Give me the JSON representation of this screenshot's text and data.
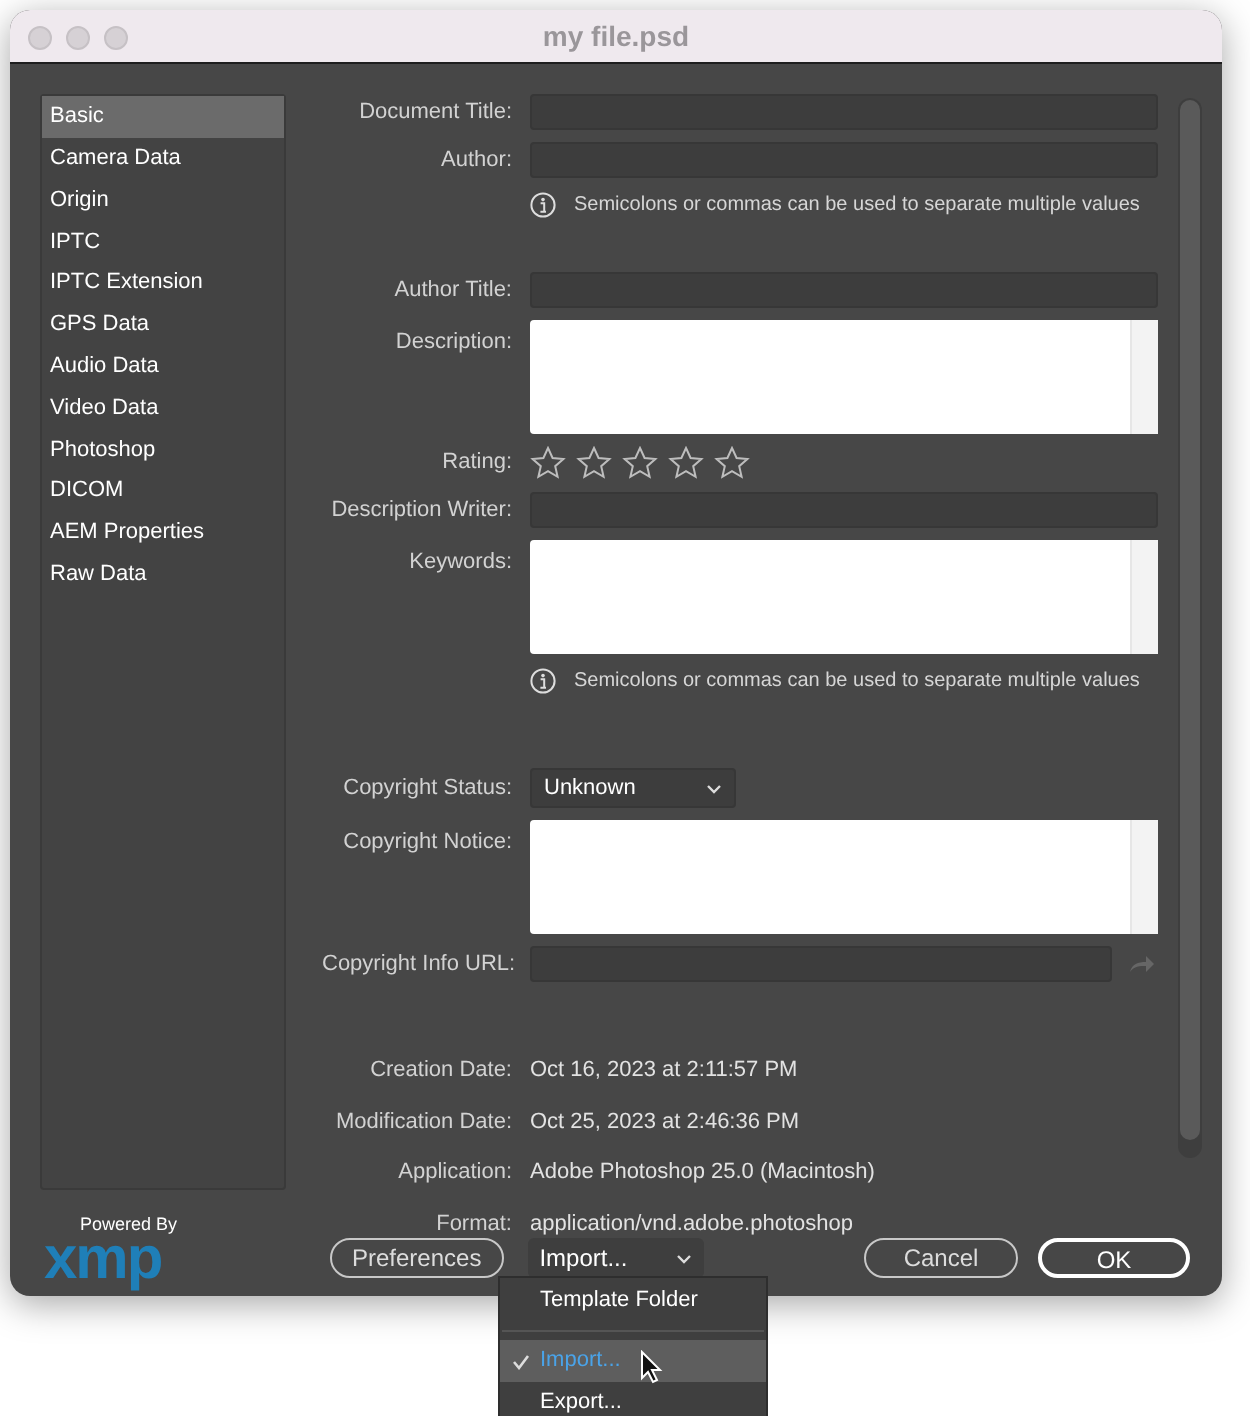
{
  "window": {
    "title": "my file.psd"
  },
  "sidebar": {
    "items": [
      {
        "label": "Basic",
        "selected": true
      },
      {
        "label": "Camera Data",
        "selected": false
      },
      {
        "label": "Origin",
        "selected": false
      },
      {
        "label": "IPTC",
        "selected": false
      },
      {
        "label": "IPTC Extension",
        "selected": false
      },
      {
        "label": "GPS Data",
        "selected": false
      },
      {
        "label": "Audio Data",
        "selected": false
      },
      {
        "label": "Video Data",
        "selected": false
      },
      {
        "label": "Photoshop",
        "selected": false
      },
      {
        "label": "DICOM",
        "selected": false
      },
      {
        "label": "AEM Properties",
        "selected": false
      },
      {
        "label": "Raw Data",
        "selected": false
      }
    ]
  },
  "sections": [
    {
      "rows": [
        {
          "kind": "text",
          "label": "Document Title:"
        },
        {
          "kind": "text",
          "label": "Author:"
        },
        {
          "kind": "note",
          "text": "Semicolons or commas can be used to separate multiple values"
        },
        {
          "kind": "text",
          "label": "Author Title:"
        },
        {
          "kind": "textarea",
          "label": "Description:"
        },
        {
          "kind": "rating",
          "label": "Rating:",
          "stars": 0
        },
        {
          "kind": "text",
          "label": "Description Writer:"
        },
        {
          "kind": "textarea",
          "label": "Keywords:"
        },
        {
          "kind": "note",
          "text": "Semicolons or commas can be used to separate multiple values"
        }
      ]
    },
    {
      "rows": [
        {
          "kind": "select",
          "label": "Copyright Status:",
          "value": "Unknown"
        },
        {
          "kind": "textarea",
          "label": "Copyright Notice:"
        },
        {
          "kind": "url",
          "label": "Copyright Info URL:"
        }
      ]
    },
    {
      "rows": [
        {
          "kind": "info",
          "label": "Creation Date:",
          "value": "Oct 16, 2023 at 2:11:57 PM"
        },
        {
          "kind": "info",
          "label": "Modification Date:",
          "value": "Oct 25, 2023 at 2:46:36 PM"
        },
        {
          "kind": "info",
          "label": "Application:",
          "value": "Adobe Photoshop 25.0 (Macintosh)"
        },
        {
          "kind": "info",
          "label": "Format:",
          "value": "application/vnd.adobe.photoshop"
        }
      ]
    }
  ],
  "logo": {
    "caption": "Powered By",
    "text": "xmp"
  },
  "footer": {
    "preferences": "Preferences",
    "menu_button": "Import...",
    "cancel": "Cancel",
    "ok": "OK"
  },
  "menu": {
    "items": [
      {
        "kind": "item",
        "label": "Template Folder",
        "selected": false
      },
      {
        "kind": "separator"
      },
      {
        "kind": "item",
        "label": "Import...",
        "selected": true
      },
      {
        "kind": "item",
        "label": "Export...",
        "selected": false
      }
    ]
  }
}
